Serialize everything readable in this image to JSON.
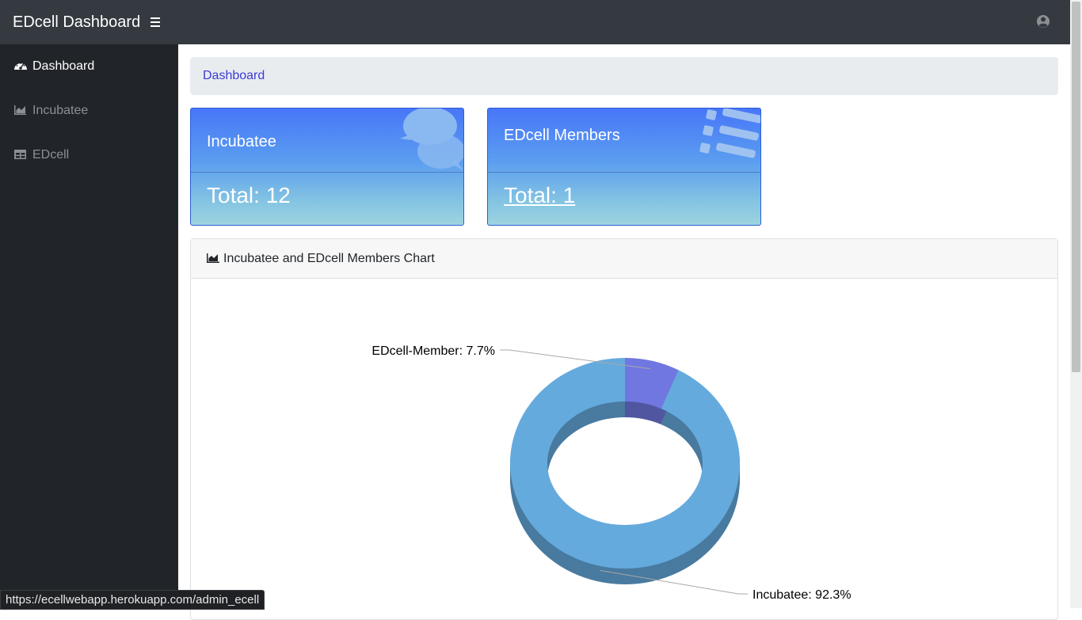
{
  "header": {
    "brand": "EDcell Dashboard",
    "menu_icon": "hamburger-icon",
    "user_icon": "user-circle-icon"
  },
  "sidebar": {
    "items": [
      {
        "label": "Dashboard",
        "icon": "tachometer-icon",
        "active": true
      },
      {
        "label": "Incubatee",
        "icon": "area-chart-icon",
        "active": false
      },
      {
        "label": "EDcell",
        "icon": "table-icon",
        "active": false
      }
    ]
  },
  "breadcrumb": {
    "label": "Dashboard"
  },
  "cards": [
    {
      "title": "Incubatee",
      "total": "Total: 12",
      "icon": "comments-icon"
    },
    {
      "title": "EDcell Members",
      "total": "Total: 1",
      "icon": "list-icon"
    }
  ],
  "chart_panel": {
    "title": "Incubatee and EDcell Members Chart",
    "icon": "area-chart-icon"
  },
  "chart_data": {
    "type": "pie",
    "variant": "3d-donut",
    "title": "",
    "slices": [
      {
        "label": "Incubatee: 92.3%",
        "name": "Incubatee",
        "value": 92.3,
        "color": "#65aadd"
      },
      {
        "label": "EDcell-Member: 7.7%",
        "name": "EDcell-Member",
        "value": 7.7,
        "color": "#7177e0"
      }
    ]
  },
  "status_bar": {
    "url": "https://ecellwebapp.herokuapp.com/admin_ecell"
  },
  "colors": {
    "topbar": "#343a40",
    "sidebar": "#212529",
    "breadcrumb_bg": "#e9ecef",
    "link": "#3a3ad6"
  }
}
